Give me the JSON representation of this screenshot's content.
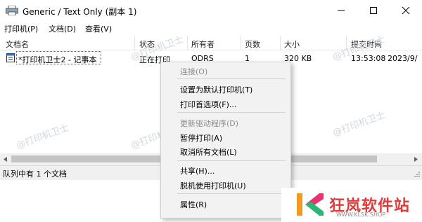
{
  "window": {
    "title": "Generic / Text Only (副本 1)"
  },
  "menubar": [
    "打印机(P)",
    "文档(D)",
    "查看(V)"
  ],
  "columns": [
    "文档名",
    "状态",
    "所有者",
    "页数",
    "大小",
    "提交时间"
  ],
  "job": {
    "name": "*打印机卫士2 - 记事本",
    "status": "正在打印",
    "owner": "ODRS",
    "pages": "1",
    "size": "320 KB",
    "time": "13:53:08",
    "date": "2023/9/"
  },
  "status_bar": "队列中有 1 个文档",
  "context_menu": {
    "connect": "连接(O)",
    "set_default": "设置为默认打印机(T)",
    "preferences": "打印首选项(F)...",
    "update_driver": "更新驱动程序(D)",
    "pause": "暂停打印(A)",
    "cancel_all": "取消所有文档(L)",
    "share": "共享(H)...",
    "offline": "脱机使用打印机(U)",
    "properties": "属性(R)"
  },
  "watermark": "@打印机卫士",
  "brand": {
    "name": "狂岚软件站",
    "url": "WWW.KLSK.SHOP",
    "colors": {
      "k_orange": "#f39a1e",
      "k_green": "#2bb673",
      "k_pink": "#e8336d",
      "text_red": "#e03a3a"
    }
  },
  "icons": [
    "printer-icon",
    "minimize-icon",
    "maximize-icon",
    "close-icon",
    "document-icon",
    "scroll-left-icon",
    "scroll-right-icon",
    "resize-grip-icon"
  ]
}
